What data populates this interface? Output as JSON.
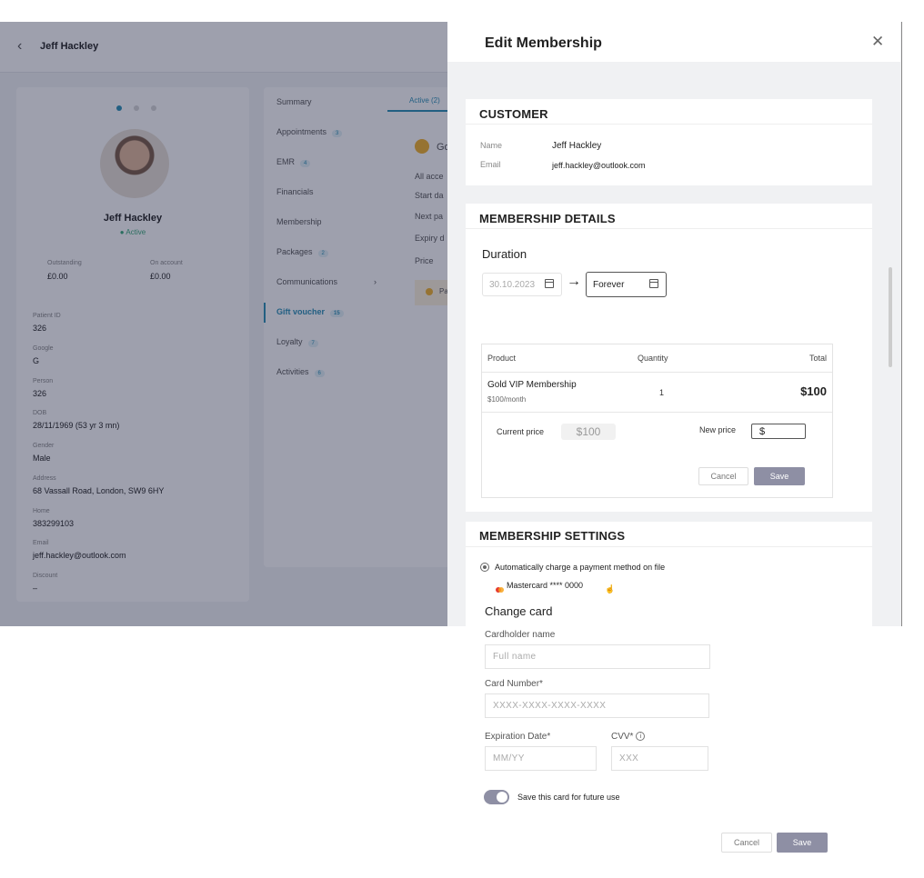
{
  "background": {
    "header_name": "Jeff Hackley",
    "profile": {
      "name": "Jeff Hackley",
      "status": "Active",
      "stats": [
        {
          "label": "Outstanding",
          "value": "£0.00"
        },
        {
          "label": "On account",
          "value": "£0.00"
        }
      ],
      "fields": [
        {
          "label": "Patient ID",
          "value": "326"
        },
        {
          "label": "Google",
          "value": "G"
        },
        {
          "label": "Person",
          "value": "326"
        },
        {
          "label": "DOB",
          "value": "28/11/1969 (53 yr 3 mn)"
        },
        {
          "label": "Gender",
          "value": "Male"
        },
        {
          "label": "Address",
          "value": "68 Vassall Road, London, SW9 6HY"
        },
        {
          "label": "Home",
          "value": "383299103"
        },
        {
          "label": "Email",
          "value": "jeff.hackley@outlook.com"
        },
        {
          "label": "Discount",
          "value": "–"
        }
      ]
    },
    "menu": [
      {
        "label": "Summary",
        "badge": ""
      },
      {
        "label": "Appointments",
        "badge": "3"
      },
      {
        "label": "EMR",
        "badge": "4"
      },
      {
        "label": "Financials",
        "badge": ""
      },
      {
        "label": "Membership",
        "badge": ""
      },
      {
        "label": "Packages",
        "badge": "2"
      },
      {
        "label": "Communications",
        "badge": ""
      },
      {
        "label": "Gift voucher",
        "badge": "15"
      },
      {
        "label": "Loyalty",
        "badge": "7"
      },
      {
        "label": "Activities",
        "badge": "6"
      }
    ],
    "tab_active": "Active (2)",
    "snippets": [
      "Go",
      "All acce",
      "Start da",
      "Next pa",
      "Expiry d",
      "Price",
      "Pa"
    ]
  },
  "drawer": {
    "title": "Edit Membership",
    "customer": {
      "section_title": "CUSTOMER",
      "name_label": "Name",
      "name_value": "Jeff Hackley",
      "email_label": "Email",
      "email_value": "jeff.hackley@outlook.com"
    },
    "details": {
      "section_title": "MEMBERSHIP DETAILS",
      "duration_label": "Duration",
      "start_date": "30.10.2023",
      "end_date": "Forever",
      "table": {
        "headers": [
          "Product",
          "Quantity",
          "Total"
        ],
        "product_name": "Gold VIP Membership",
        "product_price": "$100/month",
        "quantity": "1",
        "total": "$100",
        "current_price_label": "Current price",
        "current_price_value": "$100",
        "new_price_label": "New price",
        "new_price_value": "$",
        "cancel_label": "Cancel",
        "save_label": "Save"
      }
    },
    "settings": {
      "section_title": "MEMBERSHIP SETTINGS",
      "auto_charge_label": "Automatically charge a payment method on file",
      "card_label": "Mastercard **** 0000"
    },
    "change_card": {
      "title": "Change card",
      "cardholder_label": "Cardholder name",
      "cardholder_placeholder": "Full name",
      "card_number_label": "Card Number*",
      "card_number_placeholder": "XXXX-XXXX-XXXX-XXXX",
      "expiry_label": "Expiration Date*",
      "expiry_placeholder": "MM/YY",
      "cvv_label": "CVV*",
      "cvv_placeholder": "XXX",
      "save_card_label": "Save this card for future use",
      "save_card_on": true,
      "cancel_label": "Cancel",
      "save_label": "Save"
    }
  },
  "colors": {
    "accent": "#2a8fb6",
    "button_gray": "#8e8fa4",
    "overlay": "#191c3c"
  }
}
